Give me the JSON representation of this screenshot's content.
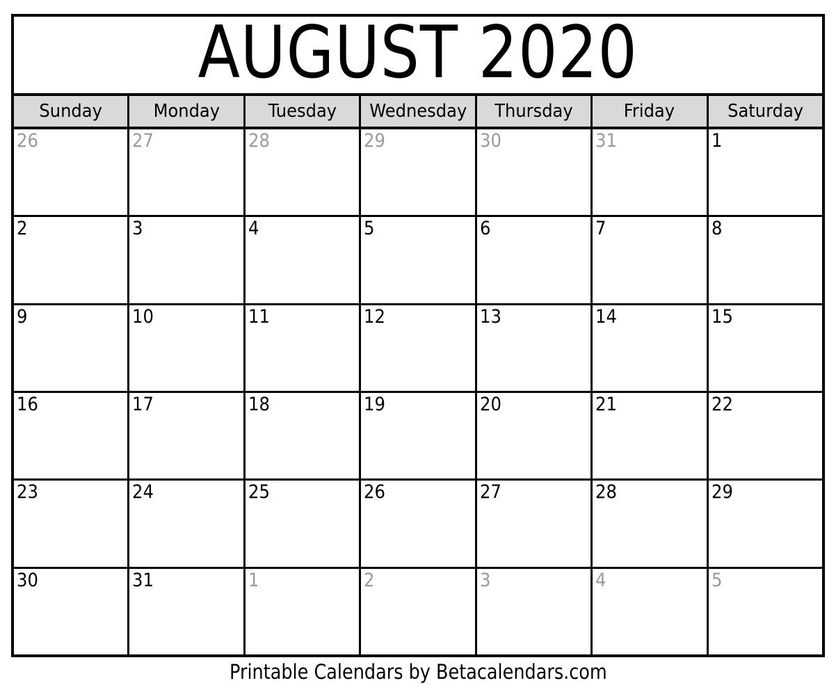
{
  "calendar": {
    "title": "AUGUST 2020",
    "month": "AUGUST",
    "year": "2020",
    "weekday_headers": [
      {
        "label": "Sunday"
      },
      {
        "label": "Monday"
      },
      {
        "label": "Tuesday"
      },
      {
        "label": "Wednesday"
      },
      {
        "label": "Thursday"
      },
      {
        "label": "Friday"
      },
      {
        "label": "Saturday"
      }
    ],
    "weeks": [
      {
        "days": [
          {
            "number": "26",
            "in_month": false
          },
          {
            "number": "27",
            "in_month": false
          },
          {
            "number": "28",
            "in_month": false
          },
          {
            "number": "29",
            "in_month": false
          },
          {
            "number": "30",
            "in_month": false
          },
          {
            "number": "31",
            "in_month": false
          },
          {
            "number": "1",
            "in_month": true
          }
        ]
      },
      {
        "days": [
          {
            "number": "2",
            "in_month": true
          },
          {
            "number": "3",
            "in_month": true
          },
          {
            "number": "4",
            "in_month": true
          },
          {
            "number": "5",
            "in_month": true
          },
          {
            "number": "6",
            "in_month": true
          },
          {
            "number": "7",
            "in_month": true
          },
          {
            "number": "8",
            "in_month": true
          }
        ]
      },
      {
        "days": [
          {
            "number": "9",
            "in_month": true
          },
          {
            "number": "10",
            "in_month": true
          },
          {
            "number": "11",
            "in_month": true
          },
          {
            "number": "12",
            "in_month": true
          },
          {
            "number": "13",
            "in_month": true
          },
          {
            "number": "14",
            "in_month": true
          },
          {
            "number": "15",
            "in_month": true
          }
        ]
      },
      {
        "days": [
          {
            "number": "16",
            "in_month": true
          },
          {
            "number": "17",
            "in_month": true
          },
          {
            "number": "18",
            "in_month": true
          },
          {
            "number": "19",
            "in_month": true
          },
          {
            "number": "20",
            "in_month": true
          },
          {
            "number": "21",
            "in_month": true
          },
          {
            "number": "22",
            "in_month": true
          }
        ]
      },
      {
        "days": [
          {
            "number": "23",
            "in_month": true
          },
          {
            "number": "24",
            "in_month": true
          },
          {
            "number": "25",
            "in_month": true
          },
          {
            "number": "26",
            "in_month": true
          },
          {
            "number": "27",
            "in_month": true
          },
          {
            "number": "28",
            "in_month": true
          },
          {
            "number": "29",
            "in_month": true
          }
        ]
      },
      {
        "days": [
          {
            "number": "30",
            "in_month": true
          },
          {
            "number": "31",
            "in_month": true
          },
          {
            "number": "1",
            "in_month": false
          },
          {
            "number": "2",
            "in_month": false
          },
          {
            "number": "3",
            "in_month": false
          },
          {
            "number": "4",
            "in_month": false
          },
          {
            "number": "5",
            "in_month": false
          }
        ]
      }
    ]
  },
  "footer": {
    "text": "Printable Calendars by Betacalendars.com"
  },
  "colors": {
    "header_background": "#d9d9d9",
    "grid_line": "#000000",
    "in_month_text": "#000000",
    "outside_month_text": "#9a9a9a",
    "page_background": "#ffffff"
  }
}
